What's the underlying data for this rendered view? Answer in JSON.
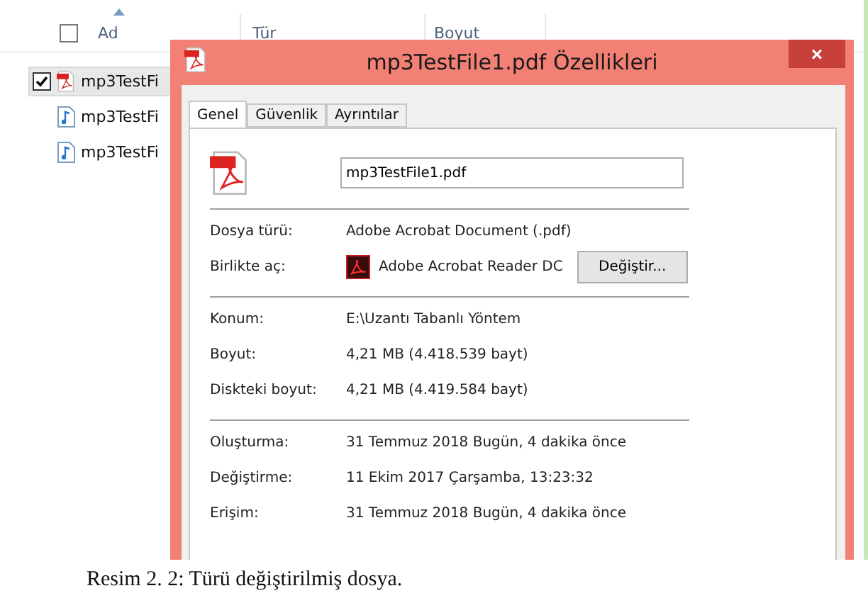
{
  "explorer": {
    "select_all_checked": false,
    "columns": [
      {
        "label": "Ad",
        "sorted": true
      },
      {
        "label": "Tür",
        "sorted": false
      },
      {
        "label": "Boyut",
        "sorted": false
      }
    ],
    "files": [
      {
        "name": "mp3TestFi",
        "kind": "pdf",
        "checked": true,
        "selected": true
      },
      {
        "name": "mp3TestFi",
        "kind": "audio",
        "checked": false,
        "selected": false
      },
      {
        "name": "mp3TestFi",
        "kind": "audio",
        "checked": false,
        "selected": false
      }
    ]
  },
  "dialog": {
    "title": "mp3TestFile1.pdf Özellikleri",
    "close": "×",
    "tabs": [
      {
        "label": "Genel",
        "selected": true
      },
      {
        "label": "Güvenlik",
        "selected": false
      },
      {
        "label": "Ayrıntılar",
        "selected": false
      }
    ],
    "file_name": "mp3TestFile1.pdf",
    "sections": [
      [
        {
          "label": "Dosya türü:",
          "value": "Adobe Acrobat Document (.pdf)"
        },
        {
          "label": "Birlikte aç:",
          "value": "Adobe Acrobat Reader DC",
          "button": "Değiştir..."
        }
      ],
      [
        {
          "label": "Konum:",
          "value": "E:\\Uzantı Tabanlı Yöntem"
        },
        {
          "label": "Boyut:",
          "value": "4,21 MB (4.418.539 bayt)"
        },
        {
          "label": "Diskteki boyut:",
          "value": "4,21 MB (4.419.584 bayt)"
        }
      ],
      [
        {
          "label": "Oluşturma:",
          "value": "31 Temmuz 2018 Bugün, 4 dakika önce"
        },
        {
          "label": "Değiştirme:",
          "value": "11 Ekim 2017 Çarşamba, 13:23:32"
        },
        {
          "label": "Erişim:",
          "value": "31 Temmuz 2018 Bugün, 4 dakika önce"
        }
      ]
    ]
  },
  "caption": "Resim 2. 2: Türü değiştirilmiş dosya."
}
